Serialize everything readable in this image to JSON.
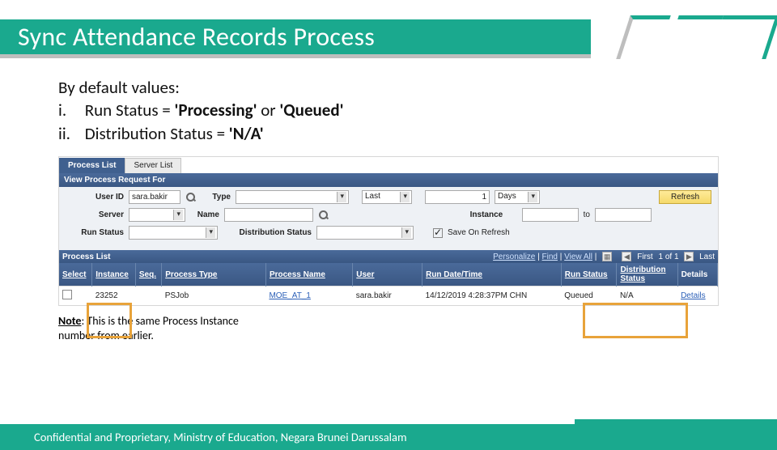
{
  "slide": {
    "title": "Sync Attendance Records Process",
    "intro": "By default values:",
    "items": [
      {
        "ord": "i.",
        "label_pre": "Run Status = ",
        "bold1": "'Processing'",
        "mid": " or ",
        "bold2": "'Queued'"
      },
      {
        "ord": "ii.",
        "label_pre": "Distribution Status = ",
        "bold1": "'N/A'",
        "mid": "",
        "bold2": ""
      }
    ],
    "note_label": "Note",
    "note_text": ": This is the same Process Instance number from earlier.",
    "footer": "Confidential and Proprietary, Ministry of Education, Negara Brunei Darussalam"
  },
  "colors": {
    "accent": "#1aa98e",
    "highlight_border": "#e8a33a",
    "header_blue": "#40608f"
  },
  "ui": {
    "tabs": {
      "active": "Process List",
      "inactive": "Server List"
    },
    "section1": "View Process Request For",
    "form": {
      "user_id_label": "User ID",
      "user_id_value": "sara.bakir",
      "type_label": "Type",
      "last_label": "Last",
      "last_value": "1",
      "last_unit": "Days",
      "refresh": "Refresh",
      "server_label": "Server",
      "name_label": "Name",
      "instance_label": "Instance",
      "to_label": "to",
      "run_status_label": "Run Status",
      "dist_status_label": "Distribution Status",
      "save_on_refresh": "Save On Refresh"
    },
    "process_list": {
      "title": "Process List",
      "bar_links": [
        "Personalize",
        "Find",
        "View All"
      ],
      "pager_text": "1 of 1",
      "first": "First",
      "last": "Last",
      "cols": [
        "Select",
        "Instance",
        "Seq.",
        "Process Type",
        "Process Name",
        "User",
        "Run Date/Time",
        "Run Status",
        "Distribution Status",
        "Details"
      ],
      "row": {
        "select": "",
        "instance": "23252",
        "seq": "",
        "ptype": "PSJob",
        "pname": "MOE_AT_1",
        "user": "sara.bakir",
        "rundt": "14/12/2019  4:28:37PM CHN",
        "rstatus": "Queued",
        "dstatus": "N/A",
        "details": "Details"
      }
    }
  }
}
